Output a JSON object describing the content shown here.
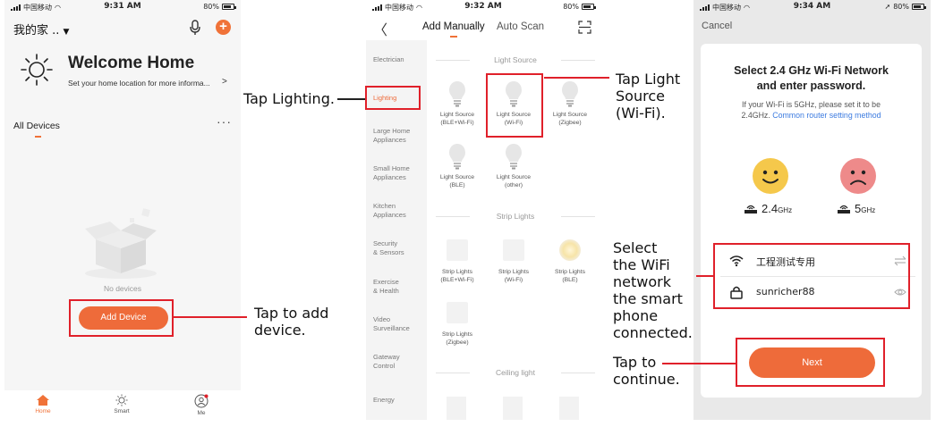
{
  "status_bars": [
    {
      "carrier": "中国移动",
      "time": "9:31 AM",
      "battery": "80%"
    },
    {
      "carrier": "中国移动",
      "time": "9:32 AM",
      "battery": "80%"
    },
    {
      "carrier": "中国移动",
      "time": "9:34 AM",
      "battery": "80%"
    }
  ],
  "home": {
    "home_name": "我的家 ..",
    "title": "Welcome Home",
    "subtitle": "Set your home location for more informa...",
    "arrow": ">",
    "section": "All Devices",
    "more": "···",
    "empty_text": "No devices",
    "add_button": "Add Device",
    "plus": "+",
    "tabs": [
      {
        "label": "Home",
        "icon": "home-icon"
      },
      {
        "label": "Smart",
        "icon": "sun-icon"
      },
      {
        "label": "Me",
        "icon": "user-icon"
      }
    ]
  },
  "add": {
    "back": "〈",
    "tab_manual": "Add Manually",
    "tab_auto": "Auto Scan",
    "categories": [
      {
        "line1": "Electrician",
        "line2": ""
      },
      {
        "line1": "Lighting",
        "line2": ""
      },
      {
        "line1": "Large Home",
        "line2": "Appliances"
      },
      {
        "line1": "Small Home",
        "line2": "Appliances"
      },
      {
        "line1": "Kitchen",
        "line2": "Appliances"
      },
      {
        "line1": "Security",
        "line2": "& Sensors"
      },
      {
        "line1": "Exercise",
        "line2": "& Health"
      },
      {
        "line1": "Video",
        "line2": "Surveillance"
      },
      {
        "line1": "Gateway",
        "line2": "Control"
      },
      {
        "line1": "Energy",
        "line2": ""
      }
    ],
    "sections": {
      "light": "Light Source",
      "strip": "Strip Lights",
      "ceiling": "Ceiling light"
    },
    "light_devices": [
      {
        "line1": "Light Source",
        "line2": "(BLE+Wi-Fi)"
      },
      {
        "line1": "Light Source",
        "line2": "(Wi-Fi)"
      },
      {
        "line1": "Light Source",
        "line2": "(Zigbee)"
      },
      {
        "line1": "Light Source",
        "line2": "(BLE)"
      },
      {
        "line1": "Light Source",
        "line2": "(other)"
      }
    ],
    "strip_devices": [
      {
        "line1": "Strip Lights",
        "line2": "(BLE+Wi-Fi)"
      },
      {
        "line1": "Strip Lights",
        "line2": "(Wi-Fi)"
      },
      {
        "line1": "Strip Lights",
        "line2": "(BLE)"
      },
      {
        "line1": "Strip Lights",
        "line2": "(Zigbee)"
      }
    ]
  },
  "wifi": {
    "cancel": "Cancel",
    "title_line1": "Select 2.4 GHz Wi-Fi Network",
    "title_line2": "and enter password.",
    "note_line1": "If your Wi-Fi is 5GHz, please set it to be",
    "note_prefix": "2.4GHz.",
    "note_link": "Common router setting method",
    "band_24": "2.4",
    "band_24_unit": "GHz",
    "band_5": "5",
    "band_5_unit": "GHz",
    "ssid": "工程测试专用",
    "password": "sunricher88",
    "next_button": "Next"
  },
  "annotations": {
    "tap_lighting": "Tap Lighting.",
    "tap_add_line1": "Tap to add",
    "tap_add_line2": "device.",
    "tap_light_line1": "Tap Light",
    "tap_light_line2": "Source",
    "tap_light_line3": "(Wi-Fi).",
    "select_line1": "Select",
    "select_line2": "the WiFi",
    "select_line3": "network",
    "select_line4": "the smart",
    "select_line5": "phone",
    "select_line6": "connected.",
    "tap_continue_line1": "Tap to",
    "tap_continue_line2": "continue."
  },
  "colors": {
    "accent": "#ee6b3a",
    "highlight": "#e0202a",
    "link": "#3c7be0"
  }
}
